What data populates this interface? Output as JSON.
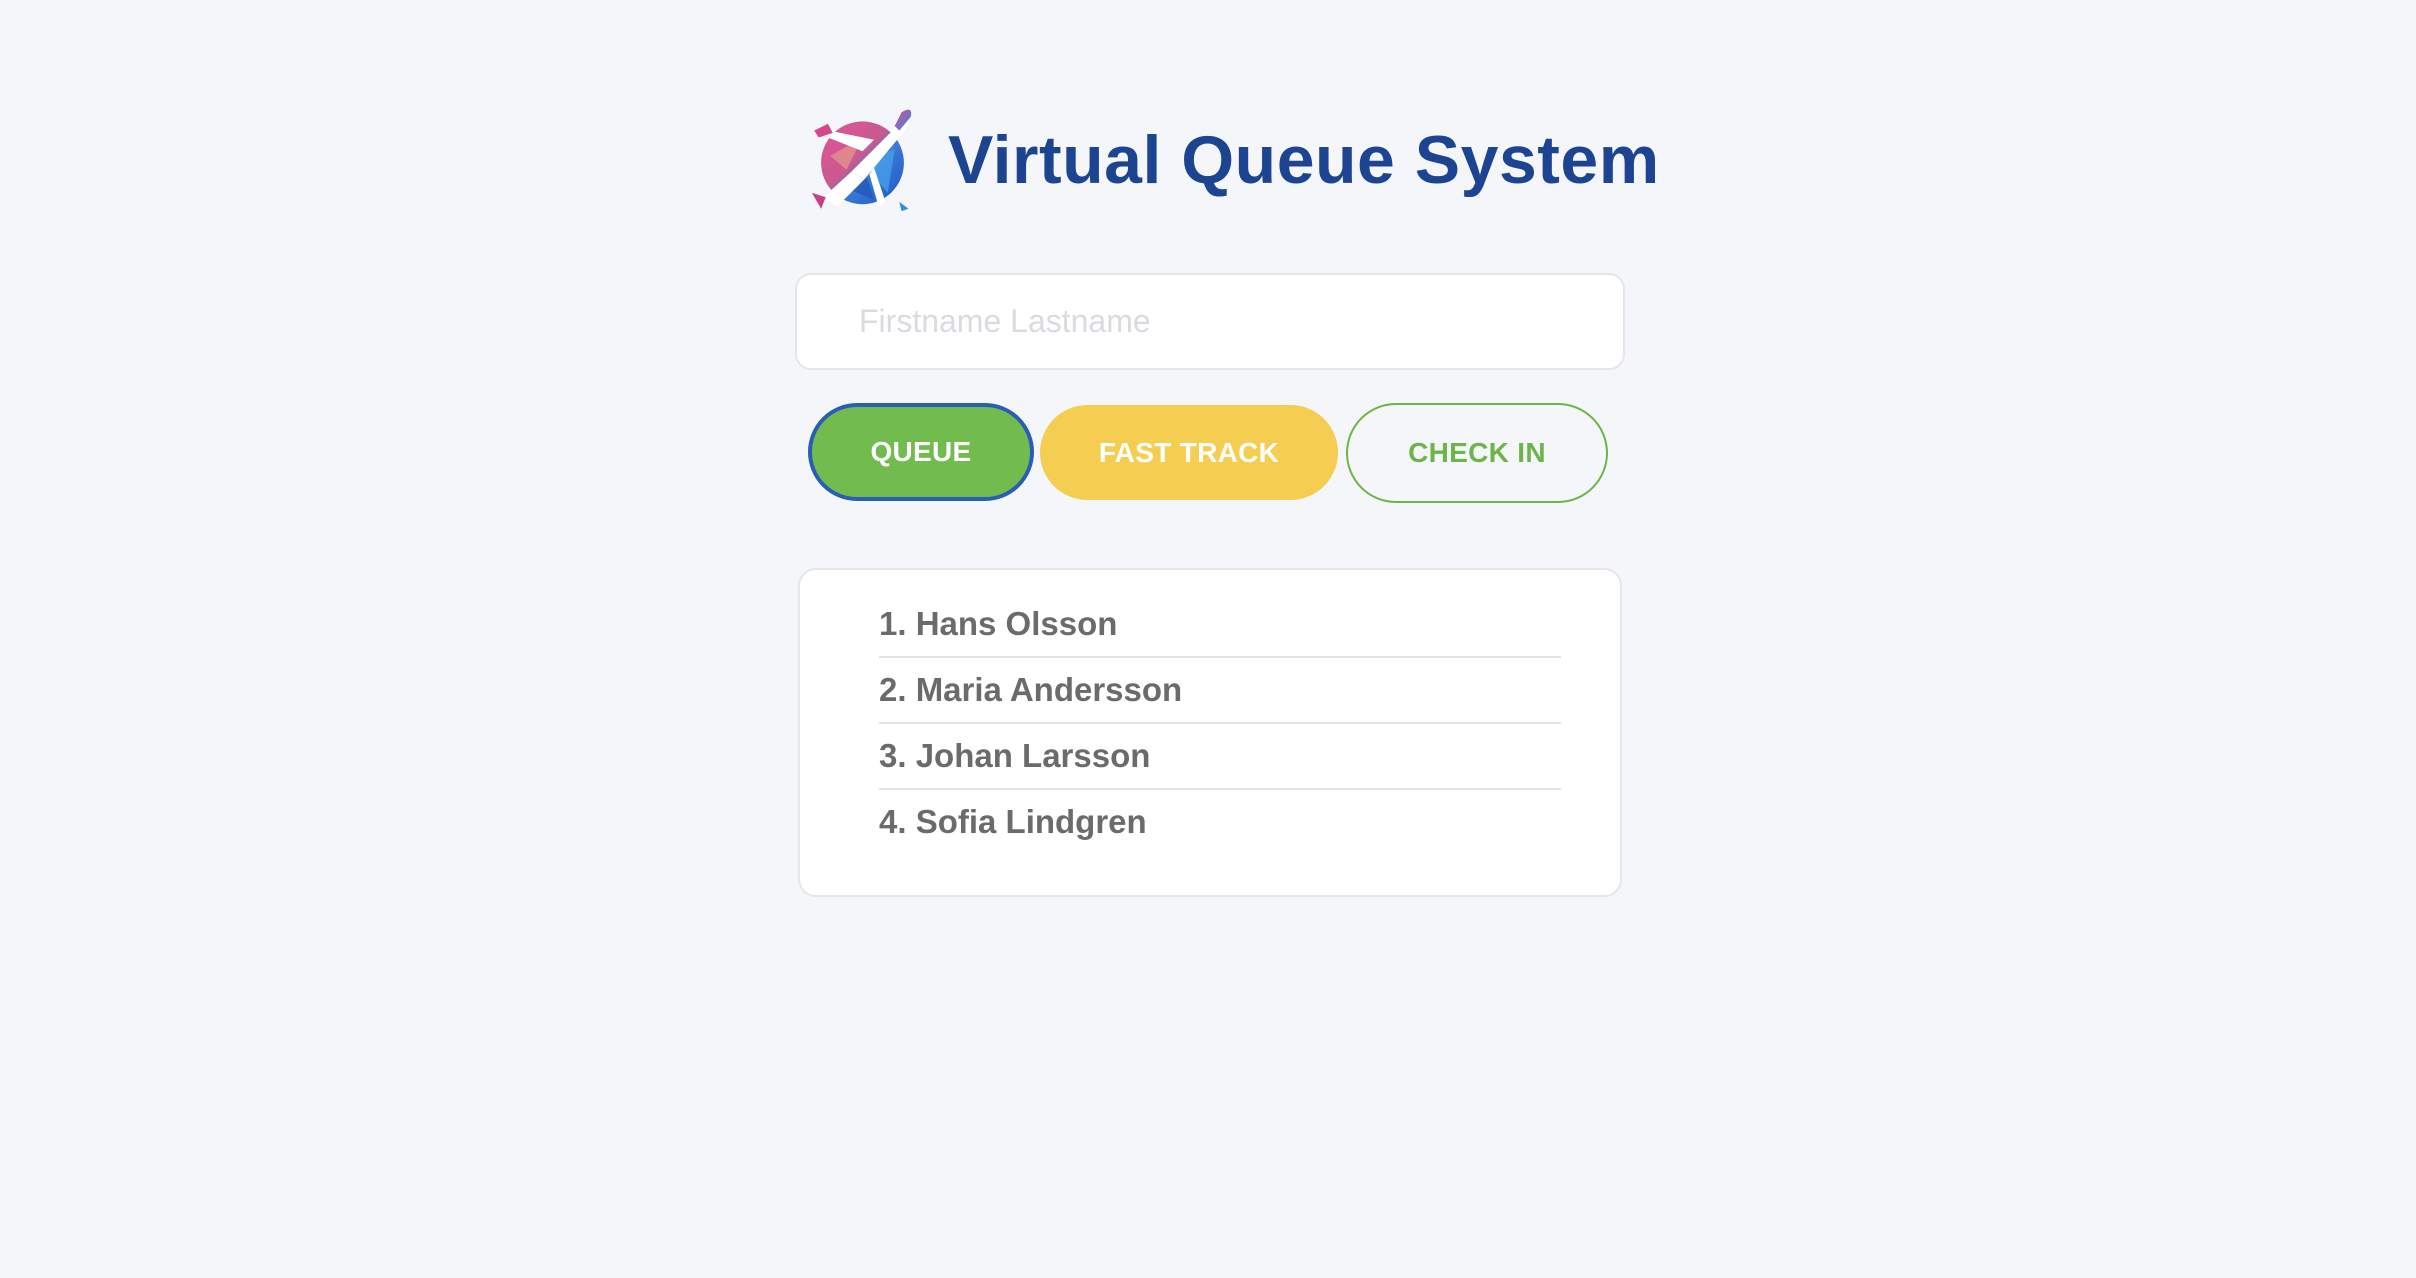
{
  "header": {
    "logo_icon": "airplane-logo-icon",
    "title": "Virtual Queue System"
  },
  "name_input": {
    "placeholder": "Firstname Lastname",
    "value": ""
  },
  "buttons": {
    "queue_label": "QUEUE",
    "fast_track_label": "FAST TRACK",
    "check_in_label": "CHECK IN"
  },
  "queue": {
    "items": [
      {
        "label": "1. Hans Olsson"
      },
      {
        "label": "2. Maria Andersson"
      },
      {
        "label": "3. Johan Larsson"
      },
      {
        "label": "4. Sofia Lindgren"
      }
    ]
  },
  "colors": {
    "title": "#1c4490",
    "queue_button": "#72bc4f",
    "queue_button_focus_border": "#2a5db5",
    "fast_track_button": "#f5cd50",
    "check_in_accent": "#6db548",
    "background": "#f5f6f9"
  }
}
